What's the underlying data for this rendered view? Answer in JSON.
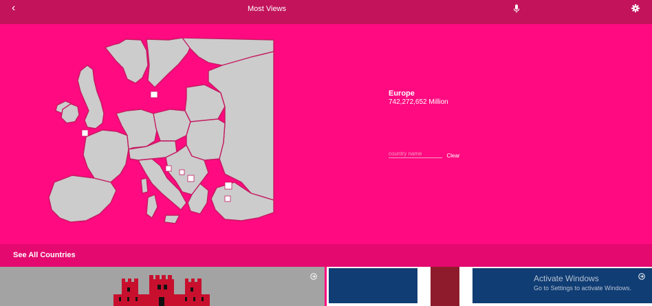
{
  "topbar": {
    "back_icon": "chevron-left-icon",
    "title": "Most Views",
    "mic_icon": "microphone-icon",
    "settings_icon": "gear-icon"
  },
  "region": {
    "name": "Europe",
    "population": "742,272,652 Million"
  },
  "search": {
    "placeholder": "country name",
    "value": "",
    "clear_label": "Clear"
  },
  "see_all": {
    "label": "See All Countries"
  },
  "cards": [
    {
      "flag": "Gibraltar",
      "arrow_icon": "arrow-right-circle-icon"
    },
    {
      "flag": "Iceland",
      "arrow_icon": "arrow-right-circle-icon"
    }
  ],
  "watermark": {
    "title": "Activate Windows",
    "subtitle": "Go to Settings to activate Windows."
  },
  "colors": {
    "topbar": "#c2135b",
    "background": "#ff0a80",
    "see_all_bar": "#e4096f",
    "map_land": "#cccccc",
    "map_border": "#c41a61"
  }
}
